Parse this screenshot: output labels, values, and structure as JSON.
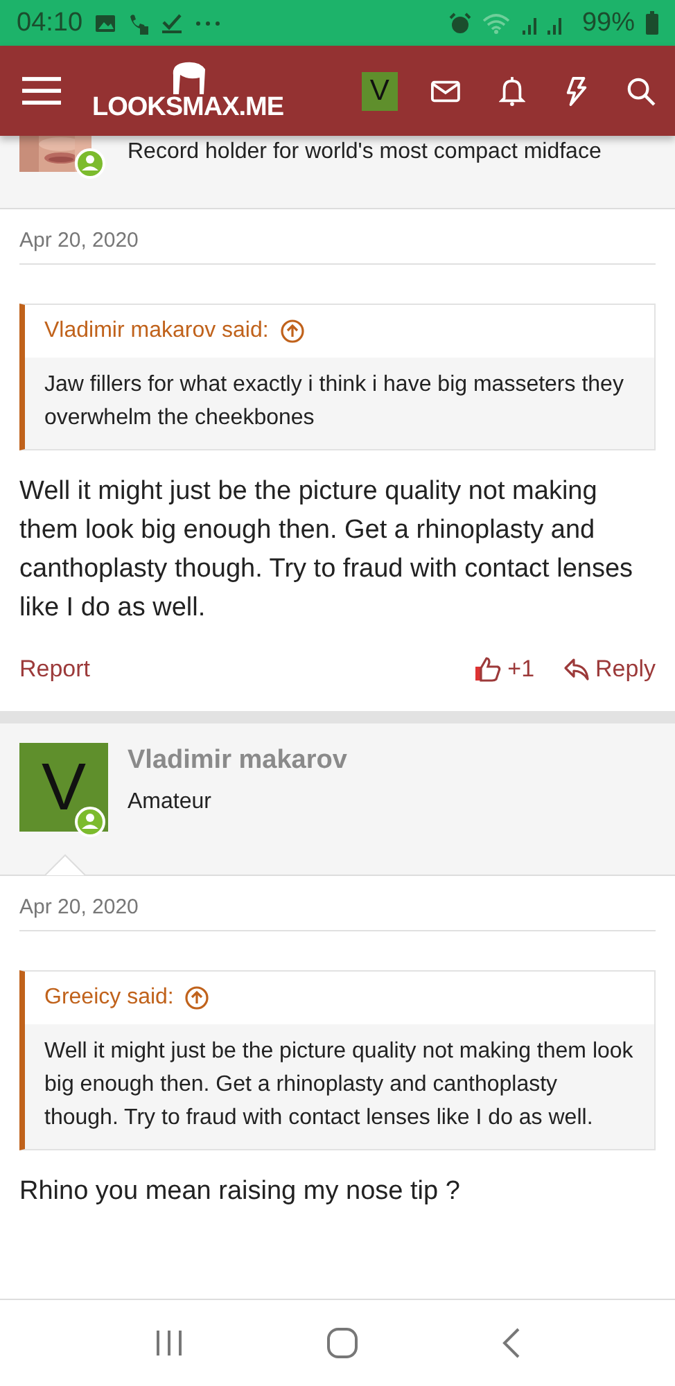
{
  "status_bar": {
    "time": "04:10",
    "battery": "99%"
  },
  "header": {
    "logo": "LOOKSMAX.ME",
    "avatar_letter": "V"
  },
  "posts": [
    {
      "user": {
        "title": "Record holder for world's most compact midface",
        "online": true
      },
      "date": "Apr 20, 2020",
      "quote": {
        "author": "Vladimir makarov said:",
        "text": "Jaw fillers for what exactly i think i have big masseters they overwhelm the cheekbones"
      },
      "body": "Well it might just be the picture quality not making them look big enough then. Get a rhinoplasty and canthoplasty though. Try to fraud with contact lenses like I do as well.",
      "actions": {
        "report": "Report",
        "reactions": "+1",
        "reply": "Reply"
      }
    },
    {
      "user": {
        "kind": "letter",
        "letter": "V",
        "name": "Vladimir makarov",
        "title": "Amateur",
        "online": true
      },
      "date": "Apr 20, 2020",
      "quote": {
        "author": "Greeicy said:",
        "text": "Well it might just be the picture quality not making them look big enough then. Get a rhinoplasty and canthoplasty though. Try to fraud with contact lenses like I do as well."
      },
      "body": "Rhino you mean raising my nose tip ?"
    }
  ]
}
